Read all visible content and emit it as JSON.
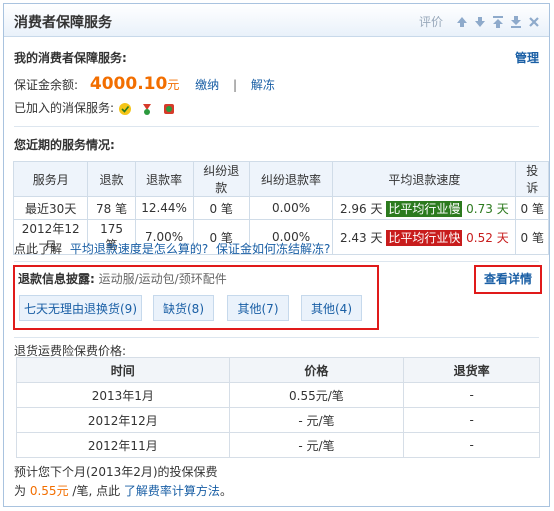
{
  "header": {
    "title": "消费者保障服务",
    "rate_label": "评价"
  },
  "my_service": {
    "title": "我的消费者保障服务:",
    "manage": "管理",
    "deposit_label": "保证金余额:",
    "deposit_amount": "4000.10",
    "deposit_unit": "元",
    "pay_link": "缴纳",
    "sep": "|",
    "unfreeze_link": "解冻",
    "joined_label": "已加入的消保服务:"
  },
  "recent": {
    "title": "您近期的服务情况:",
    "headers": [
      "服务月",
      "退款",
      "退款率",
      "纠纷退款",
      "纠纷退款率",
      "平均退款速度",
      "投诉"
    ],
    "rows": [
      {
        "month": "最近30天",
        "refund": "78 笔",
        "rate": "12.44%",
        "dispute": "0 笔",
        "dispute_rate": "0.00%",
        "speed_days": "2.96 天",
        "speed_tag": "比平均行业慢",
        "speed_diff": "0.73 天",
        "complaints": "0 笔"
      },
      {
        "month": "2012年12月",
        "refund": "175 笔",
        "rate": "7.00%",
        "dispute": "0 笔",
        "dispute_rate": "0.00%",
        "speed_days": "2.43 天",
        "speed_tag": "比平均行业快",
        "speed_diff": "0.52 天",
        "complaints": "0 笔"
      }
    ],
    "help_prefix": "点此了解",
    "help_link1": "平均退款速度是怎么算的?",
    "help_link2": "保证金如何冻结解冻?"
  },
  "refund_info": {
    "label": "退款信息披露:",
    "categories": "运动服/运动包/颈环配件",
    "detail_link": "查看详情",
    "chips": [
      "七天无理由退换货(9)",
      "缺货(8)",
      "其他(7)",
      "其他(4)"
    ]
  },
  "insurance": {
    "title": "退货运费险保费价格:",
    "headers": [
      "时间",
      "价格",
      "退货率"
    ],
    "rows": [
      {
        "time": "2013年1月",
        "price": "0.55元/笔",
        "rate": "-"
      },
      {
        "time": "2012年12月",
        "price": "- 元/笔",
        "rate": "-"
      },
      {
        "time": "2012年11月",
        "price": "- 元/笔",
        "rate": "-"
      }
    ],
    "forecast_line": "预计您下个月(2013年2月)的投保保费",
    "forecast_prefix": "为",
    "forecast_price": "0.55元",
    "forecast_suffix": "/笔, 点此",
    "forecast_link": "了解费率计算方法",
    "forecast_end": "。"
  },
  "colors": {
    "accent": "#1a5fa5",
    "amount": "#f26e00",
    "slow": "#2c7a1e",
    "fast": "#c81c1c",
    "highlight_box": "#e01a1a"
  }
}
